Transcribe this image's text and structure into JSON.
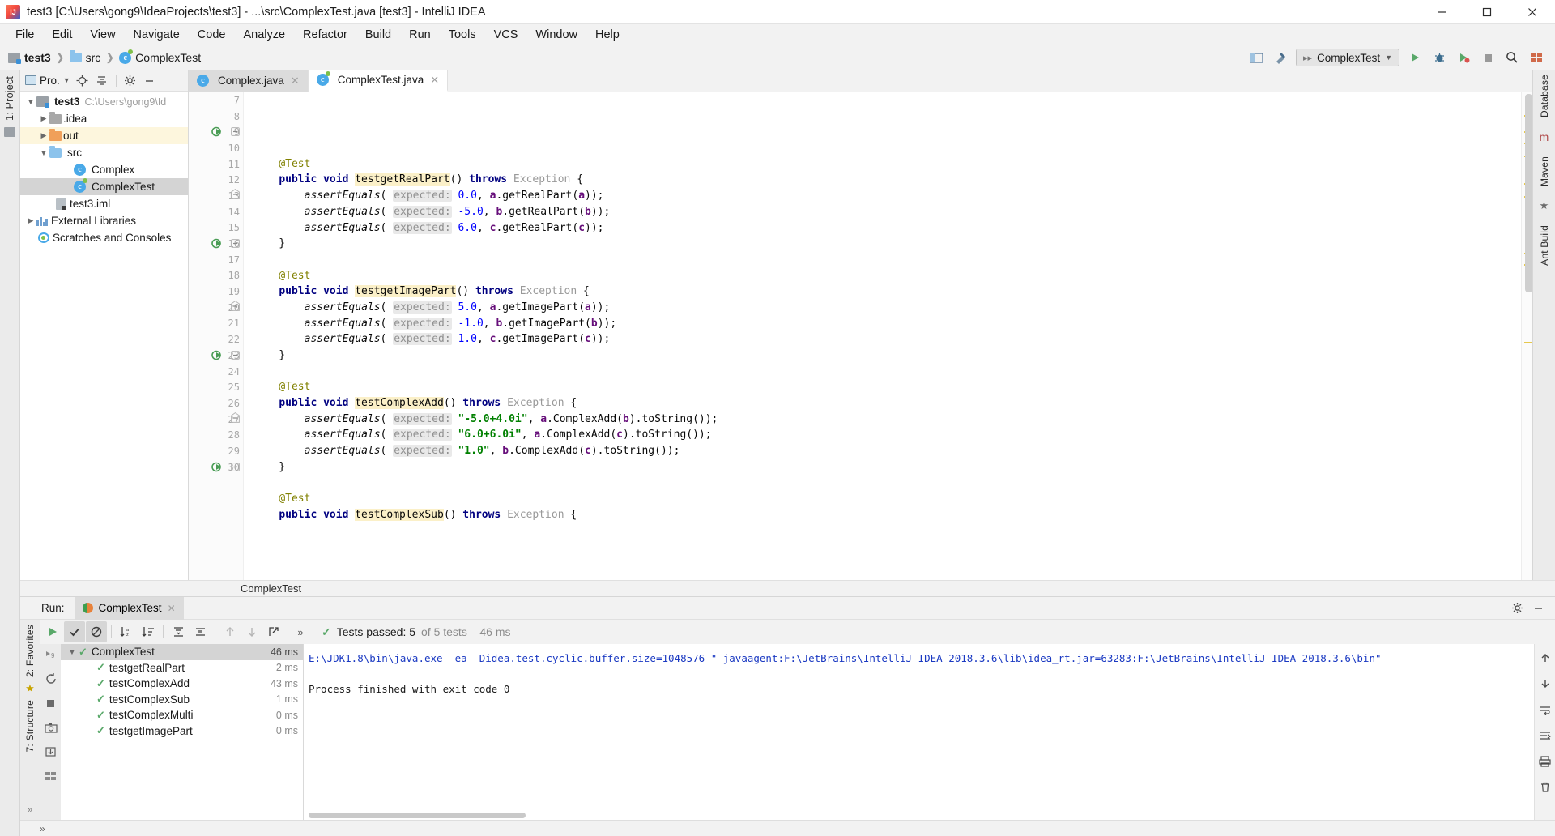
{
  "window": {
    "title": "test3 [C:\\Users\\gong9\\IdeaProjects\\test3] - ...\\src\\ComplexTest.java [test3] - IntelliJ IDEA",
    "app_icon": "intellij-idea-icon",
    "minimize_label": "Minimize",
    "maximize_label": "Maximize",
    "close_label": "Close"
  },
  "menu": {
    "items": [
      "File",
      "Edit",
      "View",
      "Navigate",
      "Code",
      "Analyze",
      "Refactor",
      "Build",
      "Run",
      "Tools",
      "VCS",
      "Window",
      "Help"
    ]
  },
  "navbar": {
    "breadcrumb": [
      {
        "label": "test3",
        "icon": "module-icon"
      },
      {
        "label": "src",
        "icon": "folder-icon"
      },
      {
        "label": "ComplexTest",
        "icon": "java-test-class-icon"
      }
    ],
    "run_config": "ComplexTest",
    "icons": [
      "project-structure-icon",
      "build-hammer-icon",
      "run-icon",
      "debug-icon",
      "run-coverage-icon",
      "stop-icon",
      "search-icon",
      "layout-icon"
    ]
  },
  "left_rail": {
    "label": "1: Project",
    "icon": "project-tool-window-icon"
  },
  "project_panel": {
    "title": "Pro.",
    "toolbar_icons": [
      "locate-icon",
      "collapse-all-icon",
      "settings-gear-icon",
      "hide-icon"
    ],
    "tree": [
      {
        "level": 0,
        "arrow": "expanded",
        "icon": "module-icon",
        "label": "test3",
        "sub": "C:\\Users\\gong9\\Id",
        "bold": true,
        "state": "normal"
      },
      {
        "level": 1,
        "arrow": "collapsed",
        "icon": "folder-grey-icon",
        "label": ".idea",
        "sub": "",
        "bold": false,
        "state": "normal"
      },
      {
        "level": 1,
        "arrow": "collapsed",
        "icon": "folder-orange-icon",
        "label": "out",
        "sub": "",
        "bold": false,
        "state": "highlighted"
      },
      {
        "level": 1,
        "arrow": "expanded",
        "icon": "folder-source-icon",
        "label": "src",
        "sub": "",
        "bold": false,
        "state": "normal"
      },
      {
        "level": 2,
        "arrow": "none",
        "icon": "java-class-icon",
        "label": "Complex",
        "sub": "",
        "bold": false,
        "state": "normal"
      },
      {
        "level": 2,
        "arrow": "none",
        "icon": "java-test-class-icon",
        "label": "ComplexTest",
        "sub": "",
        "bold": false,
        "state": "selected"
      },
      {
        "level": 1,
        "arrow": "none",
        "icon": "iml-file-icon",
        "label": "test3.iml",
        "sub": "",
        "bold": false,
        "state": "normal"
      },
      {
        "level": 0,
        "arrow": "collapsed",
        "icon": "library-icon",
        "label": "External Libraries",
        "sub": "",
        "bold": false,
        "state": "normal"
      },
      {
        "level": 0,
        "arrow": "none",
        "icon": "scratches-icon",
        "label": "Scratches and Consoles",
        "sub": "",
        "bold": false,
        "state": "normal"
      }
    ]
  },
  "editor": {
    "tabs": [
      {
        "label": "Complex.java",
        "icon": "java-class-icon",
        "active": false
      },
      {
        "label": "ComplexTest.java",
        "icon": "java-test-class-icon",
        "active": true
      }
    ],
    "first_line_number": 7,
    "lines": [
      {
        "n": 7,
        "run": false,
        "fold": false,
        "html": ""
      },
      {
        "n": 8,
        "run": false,
        "fold": false,
        "html": "    <span class=\"ann\">@Test</span>"
      },
      {
        "n": 9,
        "run": true,
        "fold": "start",
        "html": "    <span class=\"kw\">public void</span> <span class=\"hlname\">testgetRealPart</span>() <span class=\"kw\">throws</span> <span class=\"typ\">Exception</span> {"
      },
      {
        "n": 10,
        "run": false,
        "fold": false,
        "html": "        <span class=\"italic\">assertEquals</span>( <span class=\"hint\">expected:</span> <span class=\"num\">0.0</span>, <span class=\"fld\">a</span>.getRealPart(<span class=\"fld\">a</span>));"
      },
      {
        "n": 11,
        "run": false,
        "fold": false,
        "html": "        <span class=\"italic\">assertEquals</span>( <span class=\"hint\">expected:</span> <span class=\"num\">-5.0</span>, <span class=\"fld\">b</span>.getRealPart(<span class=\"fld\">b</span>));"
      },
      {
        "n": 12,
        "run": false,
        "fold": false,
        "html": "        <span class=\"italic\">assertEquals</span>( <span class=\"hint\">expected:</span> <span class=\"num\">6.0</span>, <span class=\"fld\">c</span>.getRealPart(<span class=\"fld\">c</span>));"
      },
      {
        "n": 13,
        "run": false,
        "fold": "end",
        "html": "    }"
      },
      {
        "n": 14,
        "run": false,
        "fold": false,
        "html": ""
      },
      {
        "n": 15,
        "run": false,
        "fold": false,
        "html": "    <span class=\"ann\">@Test</span>"
      },
      {
        "n": 16,
        "run": true,
        "fold": "start",
        "html": "    <span class=\"kw\">public void</span> <span class=\"hlname\">testgetImagePart</span>() <span class=\"kw\">throws</span> <span class=\"typ\">Exception</span> {"
      },
      {
        "n": 17,
        "run": false,
        "fold": false,
        "html": "        <span class=\"italic\">assertEquals</span>( <span class=\"hint\">expected:</span> <span class=\"num\">5.0</span>, <span class=\"fld\">a</span>.getImagePart(<span class=\"fld\">a</span>));"
      },
      {
        "n": 18,
        "run": false,
        "fold": false,
        "html": "        <span class=\"italic\">assertEquals</span>( <span class=\"hint\">expected:</span> <span class=\"num\">-1.0</span>, <span class=\"fld\">b</span>.getImagePart(<span class=\"fld\">b</span>));"
      },
      {
        "n": 19,
        "run": false,
        "fold": false,
        "html": "        <span class=\"italic\">assertEquals</span>( <span class=\"hint\">expected:</span> <span class=\"num\">1.0</span>, <span class=\"fld\">c</span>.getImagePart(<span class=\"fld\">c</span>));"
      },
      {
        "n": 20,
        "run": false,
        "fold": "end",
        "html": "    }"
      },
      {
        "n": 21,
        "run": false,
        "fold": false,
        "html": ""
      },
      {
        "n": 22,
        "run": false,
        "fold": false,
        "html": "    <span class=\"ann\">@Test</span>"
      },
      {
        "n": 23,
        "run": true,
        "fold": "start",
        "html": "    <span class=\"kw\">public void</span> <span class=\"hlname\">testComplexAdd</span>() <span class=\"kw\">throws</span> <span class=\"typ\">Exception</span> {"
      },
      {
        "n": 24,
        "run": false,
        "fold": false,
        "html": "        <span class=\"italic\">assertEquals</span>( <span class=\"hint\">expected:</span> <span class=\"str\">\"-5.0+4.0i\"</span>, <span class=\"fld\">a</span>.ComplexAdd(<span class=\"fld\">b</span>).toString());"
      },
      {
        "n": 25,
        "run": false,
        "fold": false,
        "html": "        <span class=\"italic\">assertEquals</span>( <span class=\"hint\">expected:</span> <span class=\"str\">\"6.0+6.0i\"</span>, <span class=\"fld\">a</span>.ComplexAdd(<span class=\"fld\">c</span>).toString());"
      },
      {
        "n": 26,
        "run": false,
        "fold": false,
        "html": "        <span class=\"italic\">assertEquals</span>( <span class=\"hint\">expected:</span> <span class=\"str\">\"1.0\"</span>, <span class=\"fld\">b</span>.ComplexAdd(<span class=\"fld\">c</span>).toString());"
      },
      {
        "n": 27,
        "run": false,
        "fold": "end",
        "html": "    }"
      },
      {
        "n": 28,
        "run": false,
        "fold": false,
        "html": ""
      },
      {
        "n": 29,
        "run": false,
        "fold": false,
        "html": "    <span class=\"ann\">@Test</span>"
      },
      {
        "n": 30,
        "run": true,
        "fold": "start",
        "html": "    <span class=\"kw\">public void</span> <span class=\"hlname\">testComplexSub</span>() <span class=\"kw\">throws</span> <span class=\"typ\">Exception</span> {"
      }
    ],
    "breadcrumb_bottom": "ComplexTest",
    "right_rail_items": [
      "Database",
      "Maven",
      "Ant Build"
    ]
  },
  "run_panel": {
    "run_label": "Run:",
    "tab_label": "ComplexTest",
    "tab_icon": "junit-icon",
    "settings_icon": "gear-icon",
    "hide_icon": "minimize-icon",
    "toolbar": {
      "rerun_icon": "run-green-icon",
      "show_passed_icon": "checkmark-filter-icon",
      "hide_ignored_icon": "circle-slash-icon",
      "sort_alpha_icon": "sort-alphabetically-icon",
      "sort_duration_icon": "sort-by-duration-icon",
      "expand_all_icon": "expand-all-icon",
      "collapse_all_icon": "collapse-all-icon",
      "prev_icon": "arrow-up-icon",
      "next_icon": "arrow-down-icon",
      "export_icon": "export-icon",
      "more_icon": "chevron-double-right-icon"
    },
    "status": {
      "icon": "check-icon",
      "main": "Tests passed: 5",
      "secondary": "of 5 tests – 46 ms"
    },
    "tests": [
      {
        "level": 0,
        "arrow": "expanded",
        "name": "ComplexTest",
        "ms": "46 ms",
        "selected": true
      },
      {
        "level": 1,
        "arrow": "none",
        "name": "testgetRealPart",
        "ms": "2 ms",
        "selected": false
      },
      {
        "level": 1,
        "arrow": "none",
        "name": "testComplexAdd",
        "ms": "43 ms",
        "selected": false
      },
      {
        "level": 1,
        "arrow": "none",
        "name": "testComplexSub",
        "ms": "1 ms",
        "selected": false
      },
      {
        "level": 1,
        "arrow": "none",
        "name": "testComplexMulti",
        "ms": "0 ms",
        "selected": false
      },
      {
        "level": 1,
        "arrow": "none",
        "name": "testgetImagePart",
        "ms": "0 ms",
        "selected": false
      }
    ],
    "console": {
      "command": "E:\\JDK1.8\\bin\\java.exe -ea -Didea.test.cyclic.buffer.size=1048576 \"-javaagent:F:\\JetBrains\\IntelliJ IDEA 2018.3.6\\lib\\idea_rt.jar=63283:F:\\JetBrains\\IntelliJ IDEA 2018.3.6\\bin\"",
      "output": "Process finished with exit code 0"
    },
    "side_icons": [
      "rerun-failed-icon",
      "rerun-auto-icon",
      "stop-icon",
      "screenshot-icon",
      "import-icon",
      "layout-icon"
    ],
    "rail_label": "2: Favorites",
    "rail_label_2": "7: Structure",
    "console_rail_icons": [
      "scroll-up-icon",
      "scroll-down-icon",
      "soft-wrap-icon",
      "scroll-to-end-icon",
      "print-icon",
      "clear-all-icon"
    ]
  },
  "colors": {
    "accent_green": "#59a869",
    "highlight_yellow": "#fbf0c8",
    "selection_grey": "#d4d4d4",
    "keyword_blue": "#000080",
    "string_green": "#008000",
    "number_blue": "#0000ff",
    "field_purple": "#660e7a",
    "annotation_olive": "#808000"
  }
}
